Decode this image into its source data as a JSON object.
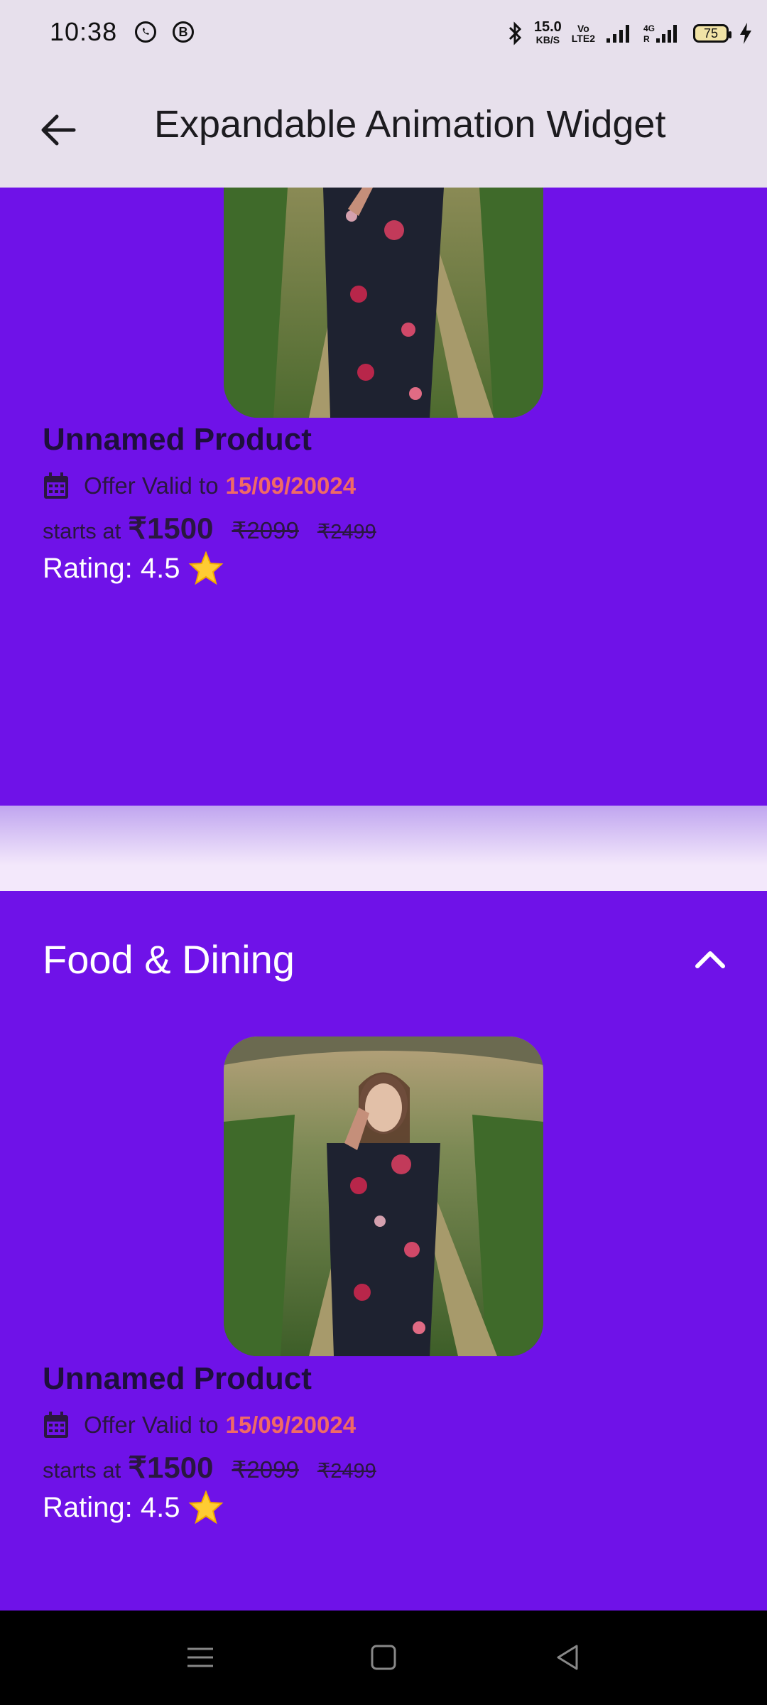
{
  "status": {
    "time": "10:38",
    "speed_value": "15.0",
    "speed_unit": "KB/S",
    "volte": "VoLTE2",
    "signal": "4G",
    "battery": "75"
  },
  "appbar": {
    "title": "Expandable Animation Widget",
    "back_icon": "arrow-back-icon"
  },
  "sections": [
    {
      "title": "",
      "product": {
        "name": "Unnamed Product",
        "offer_label": "Offer Valid to",
        "offer_date": "15/09/20024",
        "starts_label": "starts at",
        "price": "₹1500",
        "old_price_1": "₹2099",
        "old_price_2": "₹2499",
        "rating": "Rating: 4.5"
      }
    },
    {
      "title": "Food & Dining",
      "product": {
        "name": "Unnamed Product",
        "offer_label": "Offer Valid to",
        "offer_date": "15/09/20024",
        "starts_label": "starts at",
        "price": "₹1500",
        "old_price_1": "₹2099",
        "old_price_2": "₹2499",
        "rating": "Rating: 4.5"
      }
    }
  ],
  "colors": {
    "panel": "#6f12e8",
    "appbar": "#e7e0ec",
    "offer_date": "#f06a66",
    "star": "#ffcc33"
  },
  "navbar": {
    "icons": [
      "menu-icon",
      "home-square-icon",
      "back-triangle-icon"
    ]
  }
}
